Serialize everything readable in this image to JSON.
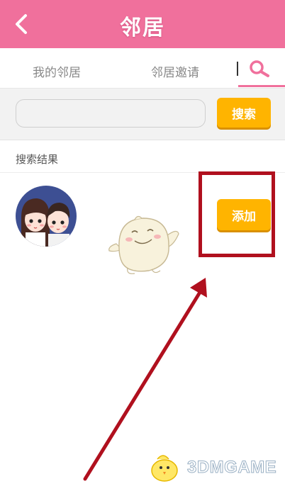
{
  "header": {
    "title": "邻居"
  },
  "tabs": [
    {
      "label": "我的邻居"
    },
    {
      "label": "邻居邀请"
    }
  ],
  "search": {
    "value": "",
    "placeholder": "",
    "button_label": "搜索"
  },
  "results": {
    "label": "搜索结果",
    "items": [
      {
        "action_label": "添加"
      }
    ]
  },
  "watermark": {
    "text": "3DMGAME"
  },
  "colors": {
    "header": "#f0709c",
    "button": "#ffb400",
    "highlight": "#b0101e"
  }
}
